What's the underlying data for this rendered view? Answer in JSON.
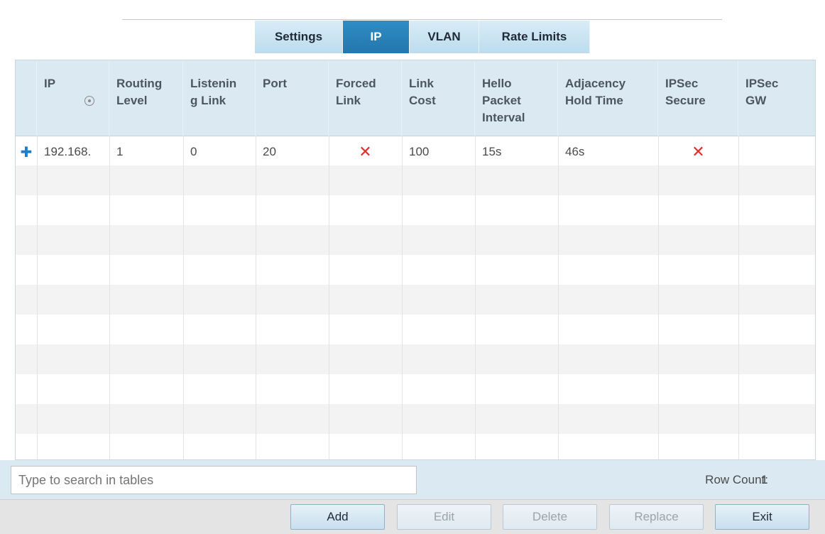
{
  "tabs": [
    {
      "label": "Settings",
      "active": false
    },
    {
      "label": "IP",
      "active": true
    },
    {
      "label": "VLAN",
      "active": false
    },
    {
      "label": "Rate Limits",
      "active": false
    }
  ],
  "table": {
    "columns": [
      {
        "label": "IP",
        "sortable": true
      },
      {
        "label": "Routing Level"
      },
      {
        "label": "Listenin g Link"
      },
      {
        "label": "Port"
      },
      {
        "label": "Forced Link"
      },
      {
        "label": "Link Cost"
      },
      {
        "label": "Hello Packet Interval"
      },
      {
        "label": "Adjacency Hold Time"
      },
      {
        "label": "IPSec Secure"
      },
      {
        "label": "IPSec GW"
      }
    ],
    "rows": [
      {
        "row_icon": "add-row-icon",
        "ip": "192.168.",
        "routing_level": "1",
        "listening_link": "0",
        "port": "20",
        "forced_link": "✕",
        "link_cost": "100",
        "hello_packet_interval": "15s",
        "adjacency_hold_time": "46s",
        "ipsec_secure": "✕",
        "ipsec_gw": ""
      }
    ]
  },
  "search": {
    "placeholder": "Type to search in tables"
  },
  "row_count": {
    "label": "Row Count:",
    "value": "1"
  },
  "buttons": {
    "add": "Add",
    "edit": "Edit",
    "delete": "Delete",
    "replace": "Replace",
    "exit": "Exit"
  },
  "colors": {
    "active_tab": "#2a82bb",
    "header_bg": "#dbe9f2",
    "x_mark": "#e32b2b"
  }
}
